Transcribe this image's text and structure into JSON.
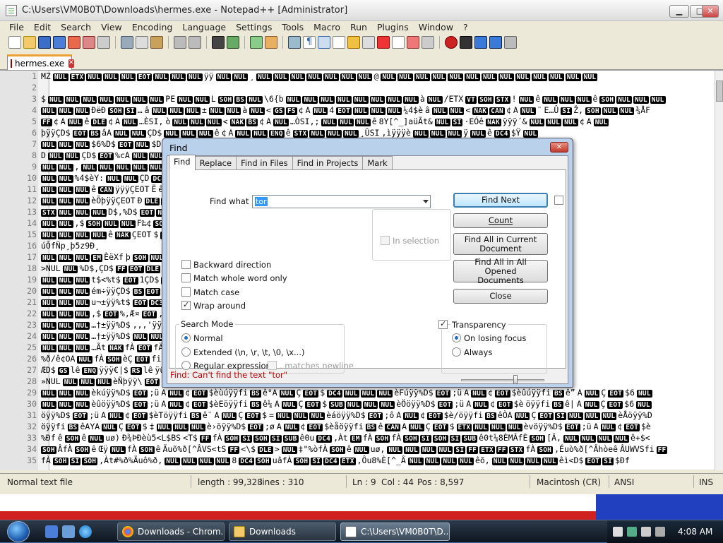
{
  "window": {
    "title": "C:\\Users\\VM0B0T\\Downloads\\hermes.exe - Notepad++ [Administrator]"
  },
  "menu": [
    "File",
    "Edit",
    "Search",
    "View",
    "Encoding",
    "Language",
    "Settings",
    "Tools",
    "Macro",
    "Run",
    "Plugins",
    "Window",
    "?"
  ],
  "tab": {
    "label": "hermes.exe"
  },
  "editor": {
    "line_numbers": [
      "1",
      "2",
      "3",
      "4",
      "5",
      "6",
      "7",
      "8",
      "9",
      "10",
      "11",
      "12",
      "13",
      "14",
      "15",
      "16",
      "17",
      "18",
      "19",
      "20",
      "21",
      "22",
      "23",
      "24",
      "25",
      "26",
      "27",
      "28",
      "29",
      "30",
      "31",
      "32",
      "33",
      "34",
      "35"
    ],
    "lines": [
      "MZ NUL ETX NUL NUL NUL EOT NUL NUL NUL ÿÿ NUL NUL ¸ NUL NUL NUL NUL NUL NUL NUL @ NUL NUL NUL NUL NUL NUL NUL NUL NUL NUL NUL NUL NUL",
      "",
      "$ NUL NUL NUL NUL NUL NUL NUL PE NUL NUL L SOH BS NUL \\6{b NUL NUL NUL NUL NUL NUL NUL NUL à NUL /ETX VT SOH STX ! NUL ê NUL NUL NUL ê SOH NUL NUL NUL",
      "NUL NUL NUL ÐëÐ SOH SI … â NUL NUL NUL ± NUL NUL à NUL < GS FS ¢ A NUL 4 EOT NUL NUL NUL ¼4$è â NUL NUL < NAK CAN ¢ A NUL ¨ E…Û SI Ž, SOH NUL NUL ¾ÅF",
      "FF ¢ A NUL ê DLE ¢ A NUL …ÈSI, ò NUL NUL NUL < NAK BS ¢ A NUL …ÒSI,; NUL NUL NUL ê 8Y[^_]aüÃt& NUL SI ·EÓê NAK ÿÿÿ´& NUL NUL NUL ¢ A NUL",
      "þÿÿÇD$ EOT BS âA NUL NUL ÇD$ NUL NUL NUL ê ¢ A NUL NUL ENQ ê STX NUL NUL NUL ¸ÛSI ,ìÿÿÿè NUL NUL NUL ÿ NUL ê DC4 $Ÿ NUL",
      "NUL NUL NUL $6%D$ EOT NUL $D*i SOH NUL NUL , NUL NUL",
      "D NUL NUL ÇD$ EOT %cA NUL NUL EOT ¢cA NUL EOT $ÿA NUL NUL",
      "NUL NUL , NUL NUL NUL NUL NUL NUL $¦ EOT $è]< NUL NUL ÇD$",
      "NUL NUL %4$èY: NUL NUL ÇD DC4 ¤ NUL NUL DLE STX",
      "NUL NUL NUL ê CAN ÿÿÿÇEOT Ë ê à NUL ê¨ÈNUL",
      "NUL NUL NUL èÕþÿÿÇEOT Ð DLE DLE NUL NUL NUL ÇD",
      "STX NUL NUL NUL D$,%D$ EOT NUL ÿ NAK Ä ANUL fi",
      "NUL NUL ,$ SOH NUL NUL F‰¢ SOH NUL NUL NUL NUL",
      "NUL NUL NUL NUL ê NAK ÇEOT $ NUL fi EOT SOH NUL NUL NUL ê&<T",
      "úÕfÑp¸þ5z9Ð¸",
      "NUL NUL NUL EM ÈëXf þ SOH NUL NUL NUL EOT $%T$ EOT ê ACK",
      ">NUL NUL %D$,ÇD$ FF EOT DLE ¢ ÀSI, Ï EOT NUL NUL Ç,",
      "NUL NUL NUL t$<%t$ EOT 1ÇD$ EOT US m A NUL <$èD",
      "NUL NUL NUL ém÷ÿÿÇD$ BS EOT A NUL fi EOT %,$ÿ NAK Ä AN",
      "NUL NUL NUL u¬±ÿÿ%t$ EOT DC3 NUL fÇ…±ÿÿ NUL",
      "NUL NUL NUL ,$ EOT %,Æ¤ EOT ,,,'ÿÿ% EOT $è@ DC3 NUL NUL NUL",
      "NUL NUL NUL …†±ÿÿ%D$ ,,,'ÿÿ% EOT $è¤ DC2 NUL NUL",
      "NUL NUL NUL …†±ÿÿ%D$ NUL NUL NUL NUL NUL ‰«Ç",
      "NUL NUL NUL …Ãt NAK fÀ EOT fÄ CAN D$ K02Å OA NUL ‰$ NUL",
      "%ð/ê¢OA NUL fÀ SOH èÇ EOT fi Â2fÇ SOH è\\A NUL t(<",
      "ÆD$ GS lê ENQ ÿÿÿ€|$ RS lê ÿûÿ NUL NUL NUL SI †ÇÿÿÿD$",
      "»NUL NUL NUL NUL èÑþÿÿ\\ EOT $ NUL NUL NUL NUL NUL NUL ê EOT $ A NUL",
      "NUL NUL NUL èkúÿÿ%D$ EOT ;ü A NUL ¢ EOT $èùúÿÿfi BS ê°A NUL Ç EOT $ DC4 NUL NUL NUL èFúÿÿ%D$ EOT ;ü A NUL ¢ EOT $èûúÿÿfi BS ê” A NUL Ç EOT $6 NUL",
      "NUL NUL NUL èûöÿÿ%D$ EOT ;ü A NUL ¢ EOT $èEöÿÿfi BS ê¼ A NUL Ç EOT $ SUB NUL NUL NUL èÖöÿÿ%D$ EOT ;ü A NUL ¢ EOT $è öÿÿfi BS ê| A NUL Ç EOT $6 NUL",
      "öÿÿ%D$ EOT ;ü A NUL ¢ EOT $èTöÿÿfi BS ê¨ A NUL Ç EOT $ = NUL NUL NUL èáöÿÿ%D$ EOT ;ô A NUL ¢ EOT $è/öÿÿfi BS êÒA NUL Ç EOT SI NUL NUL NUL èÅöÿÿ%D",
      "öÿÿfi BS êAYA NUL Ç EOT $ ‡ NUL NUL NUL è›öÿÿ%D$ EOT ;ø A NUL ¢ EOT $èåöÿÿfi BS ê CAN A NUL Ç EOT $ ETX NUL NUL NUL èvöÿÿ%D$ EOT ;ü A NUL ¢ EOT $è",
      "%Ðf ê SOH ê NUL uø) Ð¾ÞÐèù5<L$BS <T$ FF fÀ SOH SI SOH SI SUB ê0u DC4 ,Àt EM fÀ SOH fÀ SOH SI SOH SI SUB ê0t¼8ÈMÂfÈ SOH [Â, NUL NUL NUL NUL ê+$<",
      "SOH ÂfÀ SOH ê Œÿ NUL fÀ SOH ê Äuõ%ð[^ÂVS<tS FF <\\$ DLE > NUL ‡\"%òfÀ SOH ê NUL uø, NUL NUL NUL NUL SI FF ETX FF STX fÀ SOH ,Éuò%ð[^Âhòeê ÂUWVSfi FF",
      "fÀ SOH SI SOH ,Àt#%ð%Äuô%ð, NUL NUL NUL NUL 8 DC4 SOH uâfÀ SOH SI DC4 ETX ,Ôu8%È[^_Â NUL NUL NUL NUL êõ, NUL NUL NUL NUL êì<D$ EOT SI $Ðf"
    ]
  },
  "status": {
    "file_type": "Normal text file",
    "length": "length : 99,328",
    "lines": "lines : 310",
    "ln": "Ln : 9",
    "col": "Col : 44",
    "pos": "Pos : 8,597",
    "eol": "Macintosh (CR)",
    "encoding": "ANSI",
    "mode": "INS"
  },
  "dialog": {
    "title": "Find",
    "tabs": [
      "Find",
      "Replace",
      "Find in Files",
      "Find in Projects",
      "Mark"
    ],
    "find_what_label": "Find what :",
    "find_what_value": "tor",
    "buttons": {
      "find_next": "Find Next",
      "count": "Count",
      "find_all_current": "Find All in Current Document",
      "find_all_opened": "Find All in All Opened Documents",
      "close": "Close"
    },
    "in_selection": "In selection",
    "options": {
      "backward": {
        "label": "Backward direction",
        "checked": false
      },
      "whole_word": {
        "label": "Match whole word only",
        "checked": false
      },
      "match_case": {
        "label": "Match case",
        "checked": false
      },
      "wrap_around": {
        "label": "Wrap around",
        "checked": true
      }
    },
    "search_mode": {
      "title": "Search Mode",
      "normal": "Normal",
      "extended": "Extended (\\n, \\r, \\t, \\0, \\x...)",
      "regex": "Regular expression",
      "matches_newline": ". matches newline",
      "selected": "normal"
    },
    "transparency": {
      "title": "Transparency",
      "checked": true,
      "on_losing_focus": "On losing focus",
      "always": "Always",
      "selected": "on_losing_focus",
      "level": 0.65
    },
    "status_message": "Find: Can't find the text \"tor\""
  },
  "taskbar": {
    "items": [
      {
        "label": "Downloads - Chrom...",
        "active": false
      },
      {
        "label": "Downloads",
        "active": false
      },
      {
        "label": "C:\\Users\\VM0B0T\\D...",
        "active": true
      }
    ],
    "clock": "4:08 AM"
  },
  "colors": {
    "dialog_frame": "#b9d1ea",
    "error_text": "#c00000",
    "default_button_border": "#3c7fb1"
  }
}
